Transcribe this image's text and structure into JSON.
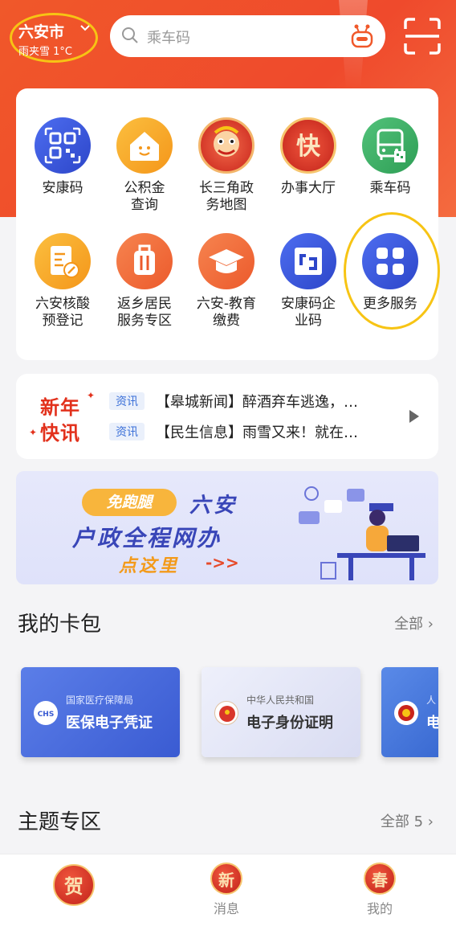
{
  "header": {
    "city": "六安市",
    "weather": "雨夹雪 1°C",
    "search_placeholder": "乘车码"
  },
  "services": [
    {
      "label": "安康码",
      "icon": "qr-code-icon",
      "color": "#3a56d6"
    },
    {
      "label": "公积金\n查询",
      "icon": "house-icon",
      "color": "#f5a623"
    },
    {
      "label": "长三角政\n务地图",
      "icon": "lion-dance-icon",
      "color": "#e3402c"
    },
    {
      "label": "办事大厅",
      "icon": "fast-char-icon",
      "color": "#e63a2a"
    },
    {
      "label": "乘车码",
      "icon": "bus-icon",
      "color": "#3fae5e"
    },
    {
      "label": "六安核酸\n预登记",
      "icon": "test-tube-icon",
      "color": "#f5a623"
    },
    {
      "label": "返乡居民\n服务专区",
      "icon": "luggage-icon",
      "color": "#f06a3a"
    },
    {
      "label": "六安-教育\n缴费",
      "icon": "graduation-cap-icon",
      "color": "#f06a3a"
    },
    {
      "label": "安康码企\n业码",
      "icon": "enterprise-code-icon",
      "color": "#3a56d6"
    },
    {
      "label": "更多服务",
      "icon": "grid-icon",
      "color": "#3a56d6"
    }
  ],
  "news": {
    "logo_line1": "新年",
    "logo_line2": "快讯",
    "items": [
      {
        "tag": "资讯",
        "text": "【皋城新闻】醉酒弃车逃逸，…"
      },
      {
        "tag": "资讯",
        "text": "【民生信息】雨雪又来！就在…"
      }
    ]
  },
  "banner": {
    "pill": "免跑腿",
    "city": "六安",
    "main": "户政全程网办",
    "cta": "点这里",
    "arrow": "->>"
  },
  "wallet": {
    "title": "我的卡包",
    "more": "全部",
    "cards": [
      {
        "org": "国家医疗保障局",
        "title": "医保电子凭证",
        "accent": "#4a6ee0"
      },
      {
        "org": "中华人民共和国",
        "title": "电子身份证明",
        "accent": "#d9dcf2"
      },
      {
        "org": "人",
        "title": "电",
        "accent": "#4a7ad8"
      }
    ]
  },
  "topics": {
    "title": "主题专区",
    "more": "全部 5"
  },
  "bottom_nav": [
    {
      "badge": "贺",
      "label": ""
    },
    {
      "badge": "新",
      "label": "消息"
    },
    {
      "badge": "春",
      "label": "我的"
    }
  ]
}
